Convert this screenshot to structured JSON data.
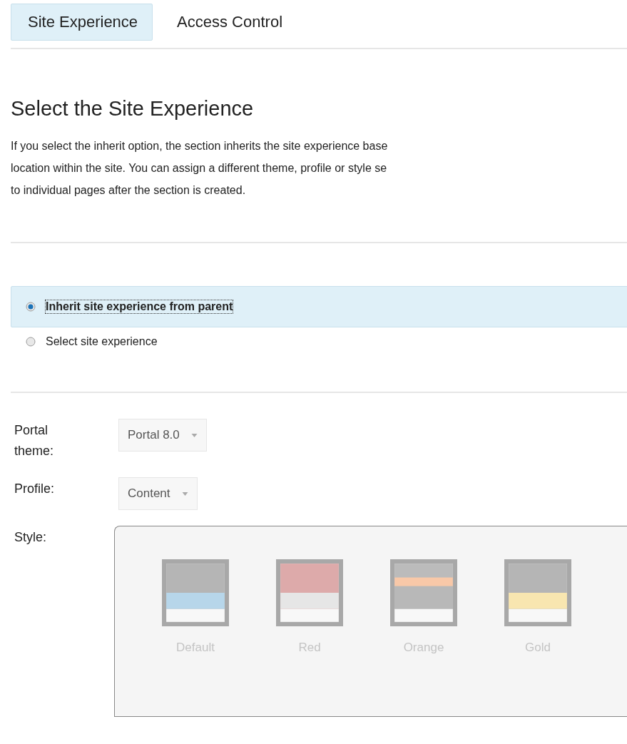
{
  "tabs": [
    {
      "label": "Site Experience",
      "selected": true
    },
    {
      "label": "Access Control",
      "selected": false
    }
  ],
  "heading": "Select the Site Experience",
  "description_lines": [
    "If you select the inherit option, the section inherits the site experience base",
    "location within the site. You can assign a different theme, profile or style se",
    "to individual pages after the section is created."
  ],
  "options": [
    {
      "label": "Inherit site experience from parent",
      "selected": true
    },
    {
      "label": "Select site experience",
      "selected": false
    }
  ],
  "fields": [
    {
      "label": "Portal theme:",
      "value": "Portal 8.0"
    },
    {
      "label": "Profile:",
      "value": "Content"
    }
  ],
  "style": {
    "label": "Style:",
    "swatches": [
      {
        "kind": "default",
        "label": "Default"
      },
      {
        "kind": "red",
        "label": "Red"
      },
      {
        "kind": "orange",
        "label": "Orange"
      },
      {
        "kind": "gold",
        "label": "Gold"
      }
    ]
  }
}
